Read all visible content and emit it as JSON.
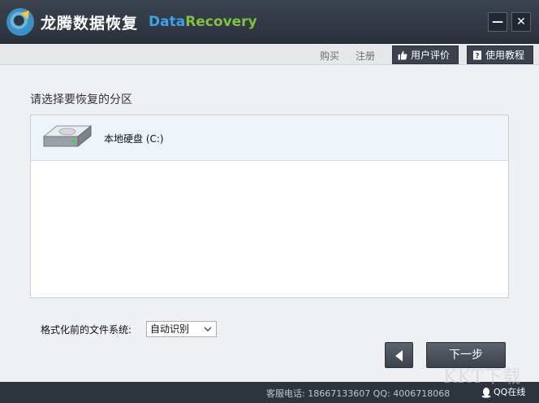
{
  "app": {
    "title": "龙腾数据恢复",
    "brand_part1": "Data",
    "brand_part2": "Recovery",
    "minimize_glyph": "—",
    "close_glyph": "✕"
  },
  "toolbar": {
    "buy_label": "购买",
    "register_label": "注册",
    "review_label": "用户评价",
    "guide_label": "使用教程"
  },
  "main": {
    "section_title": "请选择要恢复的分区",
    "partitions": [
      {
        "label": "本地硬盘 (C:)",
        "icon": "hard-drive-icon",
        "selected": true
      }
    ],
    "fs_label": "格式化前的文件系统:",
    "fs_selected": "自动识别"
  },
  "nav": {
    "next_label": "下一步"
  },
  "status": {
    "contact_text": "客服电话: 18667133607  QQ: 4006718068",
    "qq_label": "QQ在线"
  },
  "watermark": "KKT下载",
  "colors": {
    "brand_blue": "#3ba3e6",
    "brand_green": "#7fc242",
    "titlebar_bg": "#2b313b",
    "selected_row": "#edf5fb"
  }
}
